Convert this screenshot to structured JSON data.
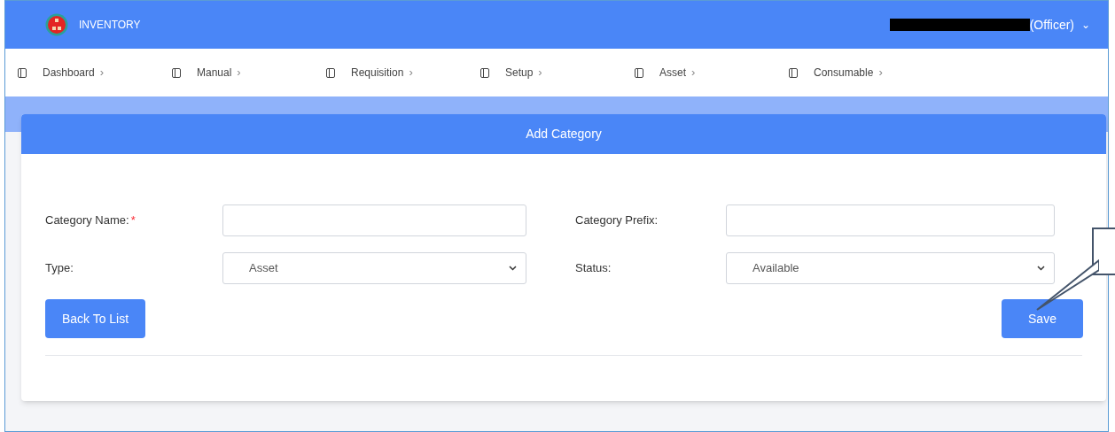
{
  "header": {
    "app_title": "INVENTORY",
    "user_role": "(Officer)",
    "user_menu_caret": "⌄"
  },
  "nav": [
    {
      "label": "Dashboard",
      "chevron": "›"
    },
    {
      "label": "Manual",
      "chevron": "›"
    },
    {
      "label": "Requisition",
      "chevron": "›"
    },
    {
      "label": "Setup",
      "chevron": "›"
    },
    {
      "label": "Asset",
      "chevron": "›"
    },
    {
      "label": "Consumable",
      "chevron": "›"
    }
  ],
  "form": {
    "title": "Add Category",
    "fields": [
      {
        "label": "Category Name:",
        "required": true,
        "kind": "text"
      },
      {
        "label": "Category Prefix:",
        "required": false,
        "kind": "text"
      },
      {
        "label": "Type:",
        "required": false,
        "kind": "select",
        "value": "Asset"
      },
      {
        "label": "Status:",
        "required": false,
        "kind": "select",
        "value": "Available"
      }
    ],
    "required_mark": "*",
    "back_button": "Back To List",
    "save_button": "Save"
  }
}
